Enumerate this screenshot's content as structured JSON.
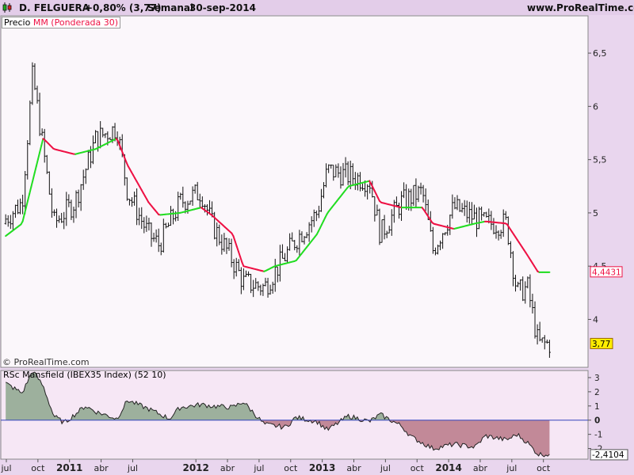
{
  "header": {
    "instrument": "D. FELGUERA",
    "change": "+0,80% (3,77)",
    "period": "Semanal",
    "date": "30-sep-2014",
    "site": "www.ProRealTime.com"
  },
  "chart_data": [
    {
      "type": "line",
      "panel": "price",
      "legend": [
        "Precio",
        "MM (Ponderada 30)"
      ],
      "copyright": "© ProRealTime.com",
      "y_ticks": [
        "6,5",
        "6",
        "5,5",
        "5",
        "4,5",
        "4"
      ],
      "y_tick_values": [
        6.5,
        6.0,
        5.5,
        5.0,
        4.5,
        4.0
      ],
      "ylim": [
        3.55,
        6.85
      ],
      "last_price": "3,77",
      "ma_last": "4,4431",
      "colors": {
        "ma_up": "#22dd22",
        "ma_down": "#ee1144",
        "bars": "#111111",
        "last_badge": "#ffee00"
      },
      "series": [
        {
          "name": "Precio",
          "x": [
            "2010-06",
            "2010-08",
            "2010-09",
            "2010-10",
            "2010-11",
            "2011-01",
            "2011-03",
            "2011-05",
            "2011-06",
            "2011-08",
            "2011-09",
            "2011-11",
            "2012-01",
            "2012-02",
            "2012-04",
            "2012-05",
            "2012-07",
            "2012-08",
            "2012-10",
            "2012-12",
            "2013-01",
            "2013-03",
            "2013-05",
            "2013-06",
            "2013-08",
            "2013-10",
            "2013-11",
            "2014-01",
            "2014-03",
            "2014-04",
            "2014-06",
            "2014-07",
            "2014-08",
            "2014-09"
          ],
          "values": [
            4.9,
            5.1,
            6.3,
            5.6,
            4.9,
            5.1,
            5.7,
            5.8,
            5.2,
            4.8,
            4.7,
            5.1,
            5.2,
            4.9,
            4.55,
            4.35,
            4.3,
            4.45,
            4.75,
            5.0,
            5.4,
            5.35,
            5.3,
            4.8,
            5.1,
            5.2,
            4.65,
            5.05,
            4.95,
            4.9,
            4.9,
            4.25,
            4.3,
            3.77
          ]
        },
        {
          "name": "MM (Ponderada 30)",
          "x": [
            "2010-06",
            "2010-08",
            "2010-09",
            "2010-10",
            "2010-11",
            "2011-01",
            "2011-03",
            "2011-05",
            "2011-06",
            "2011-08",
            "2011-09",
            "2011-11",
            "2012-01",
            "2012-02",
            "2012-04",
            "2012-05",
            "2012-07",
            "2012-08",
            "2012-10",
            "2012-12",
            "2013-01",
            "2013-03",
            "2013-05",
            "2013-06",
            "2013-08",
            "2013-10",
            "2013-11",
            "2014-01",
            "2014-03",
            "2014-04",
            "2014-06",
            "2014-07",
            "2014-08",
            "2014-09"
          ],
          "values": [
            4.75,
            4.9,
            5.3,
            5.7,
            5.6,
            5.55,
            5.6,
            5.7,
            5.45,
            5.1,
            4.98,
            5.0,
            5.05,
            4.98,
            4.8,
            4.5,
            4.45,
            4.5,
            4.55,
            4.8,
            5.0,
            5.25,
            5.3,
            5.1,
            5.05,
            5.05,
            4.9,
            4.85,
            4.9,
            4.92,
            4.9,
            4.75,
            4.6,
            4.4431
          ]
        }
      ]
    },
    {
      "type": "area",
      "panel": "indicator",
      "legend": "RSc Mansfield (IBEX35 Index) (52 10)",
      "y_ticks": [
        "3",
        "2",
        "1",
        "0",
        "-1",
        "-2"
      ],
      "y_tick_values": [
        3,
        2,
        1,
        0,
        -1,
        -2
      ],
      "ylim": [
        -2.75,
        3.5
      ],
      "last_value": "-2,4104",
      "colors": {
        "positive": "#7f9e7f",
        "negative": "#b06a78",
        "zero_line": "#3344bb"
      },
      "x_ticks": [
        "jul",
        "oct",
        "2011",
        "abr",
        "jul",
        "2012",
        "abr",
        "jul",
        "oct",
        "2013",
        "abr",
        "jul",
        "oct",
        "2014",
        "abr",
        "jul",
        "oct"
      ],
      "x": [
        "2010-06",
        "2010-08",
        "2010-09",
        "2010-10",
        "2010-11",
        "2010-12",
        "2011-02",
        "2011-03",
        "2011-05",
        "2011-06",
        "2011-08",
        "2011-10",
        "2011-11",
        "2012-01",
        "2012-02",
        "2012-04",
        "2012-05",
        "2012-07",
        "2012-09",
        "2012-10",
        "2012-12",
        "2013-01",
        "2013-03",
        "2013-05",
        "2013-06",
        "2013-08",
        "2013-09",
        "2013-11",
        "2014-01",
        "2014-03",
        "2014-04",
        "2014-06",
        "2014-07",
        "2014-08",
        "2014-09"
      ],
      "values": [
        2.8,
        1.9,
        3.5,
        2.4,
        0.3,
        -0.2,
        1.0,
        0.6,
        0.1,
        1.4,
        0.8,
        0.1,
        0.9,
        1.1,
        1.0,
        0.9,
        1.3,
        -0.3,
        -0.5,
        0.2,
        -0.1,
        -0.7,
        0.3,
        -0.1,
        0.4,
        -0.4,
        -1.2,
        -2.0,
        -1.7,
        -1.9,
        -1.1,
        -1.4,
        -1.0,
        -1.6,
        -2.41
      ]
    }
  ]
}
